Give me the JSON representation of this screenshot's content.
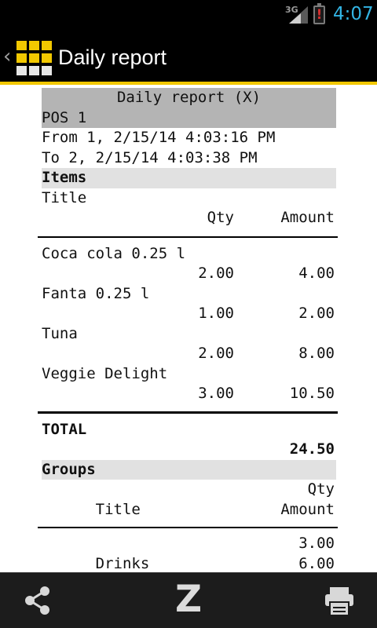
{
  "status_bar": {
    "network": "3G",
    "time": "4:07",
    "battery_alert": "!",
    "accent_color": "#33b5e5"
  },
  "action_bar": {
    "title": "Daily report",
    "up_glyph": "‹",
    "accent_color": "#f2c800"
  },
  "report": {
    "title": "Daily report (X)",
    "pos": "POS 1",
    "from": "From 1, 2/15/14 4:03:16 PM",
    "to": "To 2, 2/15/14 4:03:38 PM",
    "items_section": "Items",
    "items_header": {
      "title": "Title",
      "qty": "Qty",
      "amount": "Amount"
    },
    "items": [
      {
        "name": "Coca cola 0.25 l",
        "qty": "2.00",
        "amount": "4.00"
      },
      {
        "name": "Fanta 0.25 l",
        "qty": "1.00",
        "amount": "2.00"
      },
      {
        "name": "Tuna",
        "qty": "2.00",
        "amount": "8.00"
      },
      {
        "name": "Veggie Delight",
        "qty": "3.00",
        "amount": "10.50"
      }
    ],
    "total_label": "TOTAL",
    "total_value": "24.50",
    "groups_section": "Groups",
    "groups_header": {
      "title": "Title",
      "qty": "Qty",
      "amount": "Amount"
    },
    "groups": [
      {
        "name": "Drinks",
        "qty": "3.00",
        "amount": "6.00"
      }
    ]
  },
  "bottom_bar": {
    "share_icon": "share-icon",
    "z_label": "Z",
    "print_icon": "printer-icon"
  }
}
